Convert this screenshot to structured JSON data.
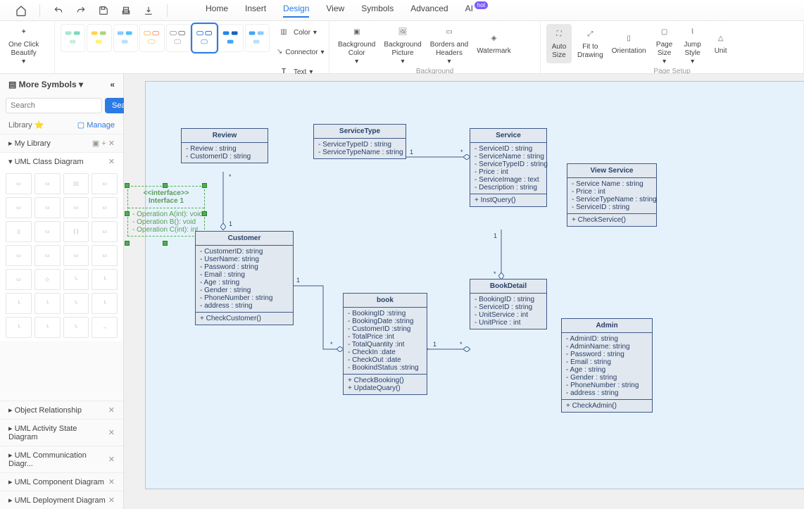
{
  "toolbar": {
    "menus": [
      "Home",
      "Insert",
      "Design",
      "View",
      "Symbols",
      "Advanced",
      "AI"
    ],
    "active_menu": "Design",
    "hot_tag": "hot"
  },
  "ribbon": {
    "one_click": "One Click\nBeautify",
    "beautify_label": "Beautify",
    "color": "Color",
    "connector": "Connector",
    "text": "Text",
    "bg_color": "Background\nColor",
    "bg_picture": "Background\nPicture",
    "borders": "Borders and\nHeaders",
    "watermark": "Watermark",
    "background_label": "Background",
    "auto_size": "Auto\nSize",
    "fit_drawing": "Fit to\nDrawing",
    "orientation": "Orientation",
    "page_size": "Page\nSize",
    "jump_style": "Jump\nStyle",
    "unit": "Unit",
    "page_setup_label": "Page Setup"
  },
  "sidebar": {
    "more_symbols": "More Symbols",
    "search_placeholder": "Search",
    "search_btn": "Search",
    "library": "Library",
    "manage": "Manage",
    "my_library": "My Library",
    "uml_class": "UML Class Diagram",
    "sections": [
      "Object Relationship",
      "UML Activity State Diagram",
      "UML Communication Diagr...",
      "UML Component Diagram",
      "UML Deployment Diagram"
    ]
  },
  "diagram": {
    "review": {
      "title": "Review",
      "attrs": [
        "- Review : string",
        "- CustomerID : string"
      ]
    },
    "servicetype": {
      "title": "ServiceType",
      "attrs": [
        "- ServiceTypeID : string",
        "- ServiceTypeName : string"
      ]
    },
    "service": {
      "title": "Service",
      "attrs": [
        "- ServiceID : string",
        "- ServiceName : string",
        "- ServiceTypeID : string",
        "- Price : int",
        "- ServiceImage : text",
        "- Description : string"
      ],
      "ops": [
        "+ InstQuery()"
      ]
    },
    "viewservice": {
      "title": "View Service",
      "attrs": [
        "- Service Name : string",
        "- Price : int",
        "- ServiceTypeName : string",
        "- ServiceID : string"
      ],
      "ops": [
        "+ CheckService()"
      ]
    },
    "interface": {
      "stereo": "<<interface>>",
      "name": "Interface 1",
      "ops": [
        "- Operation A(int): void",
        "- Operation B(): void",
        "- Operation C(int): int"
      ]
    },
    "customer": {
      "title": "Customer",
      "attrs": [
        "- CustomerID: string",
        "- UserName: string",
        "- Password : string",
        "- Email : string",
        "- Age : string",
        "- Gender : string",
        "- PhoneNumber : string",
        "- address : string"
      ],
      "ops": [
        "+ CheckCustomer()"
      ]
    },
    "book": {
      "title": "book",
      "attrs": [
        "- BookingID :string",
        "- BookingDate :string",
        "- CustomerID :string",
        "- TotalPrice :int",
        "- TotalQuantity :int",
        "- CheckIn :date",
        "- CheckOut :date",
        "- BookindStatus :string"
      ],
      "ops": [
        "+ CheckBooking()",
        "+ UpdateQuary()"
      ]
    },
    "bookdetail": {
      "title": "BookDetail",
      "attrs": [
        "- BookingID : string",
        "- ServiceID : string",
        "- UnitService : int",
        "- UnitPrice : int"
      ]
    },
    "admin": {
      "title": "Admin",
      "attrs": [
        "- AdminID: string",
        "- AdminName: string",
        "- Password : string",
        "- Email : string",
        "- Age : string",
        "- Gender : string",
        "- PhoneNumber : string",
        "- address : string"
      ],
      "ops": [
        "+ CheckAdmin()"
      ]
    },
    "multiplicity": {
      "one": "1",
      "star": "*"
    }
  }
}
